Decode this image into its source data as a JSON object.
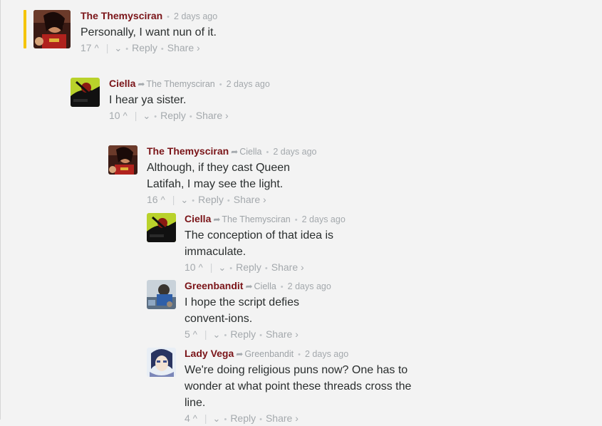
{
  "ui": {
    "reply_label": "Reply",
    "share_label": "Share ›",
    "up_glyph": "^",
    "down_glyph": "⌄",
    "reply_arrow_glyph": "➦",
    "dot_glyph": "•",
    "sep_glyph": "|"
  },
  "comments": [
    {
      "author": "The Themysciran",
      "parent": "",
      "time": "2 days ago",
      "text": "Personally, I want nun of it.",
      "votes": "17",
      "avatar": "themysciran-avatar",
      "highlighted": true
    },
    {
      "author": "Ciella",
      "parent": "The Themysciran",
      "time": "2 days ago",
      "text": "I hear ya sister.",
      "votes": "10",
      "avatar": "ciella-avatar"
    },
    {
      "author": "The Themysciran",
      "parent": "Ciella",
      "time": "2 days ago",
      "text": "Although, if they cast Queen Latifah, I may see the light.",
      "votes": "16",
      "avatar": "themysciran-avatar"
    },
    {
      "author": "Ciella",
      "parent": "The Themysciran",
      "time": "2 days ago",
      "text": "The conception of that idea is immaculate.",
      "votes": "10",
      "avatar": "ciella-avatar"
    },
    {
      "author": "Greenbandit",
      "parent": "Ciella",
      "time": "2 days ago",
      "text": "I hope the script defies convent-ions.",
      "votes": "5",
      "avatar": "greenbandit-avatar"
    },
    {
      "author": "Lady Vega",
      "parent": "Greenbandit",
      "time": "2 days ago",
      "text": "We're doing religious puns now? One has to wonder at what point these threads cross the line.",
      "votes": "4",
      "avatar": "lady-vega-avatar"
    }
  ]
}
